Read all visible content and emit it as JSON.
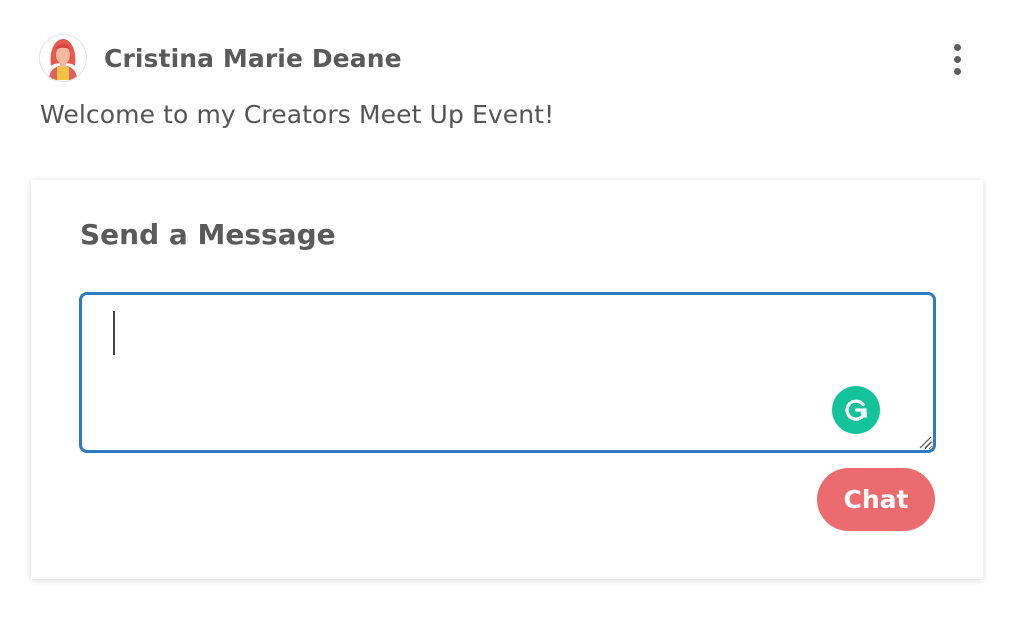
{
  "post": {
    "author_name": "Cristina Marie Deane",
    "avatar_icon": "user-avatar-icon",
    "more_icon": "more-vertical-icon",
    "welcome_text": "Welcome to my Creators Meet Up Event!"
  },
  "message_form": {
    "title": "Send a Message",
    "input_value": "",
    "input_placeholder": "",
    "grammarly_icon": "grammarly-icon",
    "chat_button_label": "Chat"
  },
  "colors": {
    "accent_button": "#ec6b6f",
    "input_focus_border": "#2f7bbf",
    "grammarly": "#15c39a",
    "text": "#555555"
  }
}
